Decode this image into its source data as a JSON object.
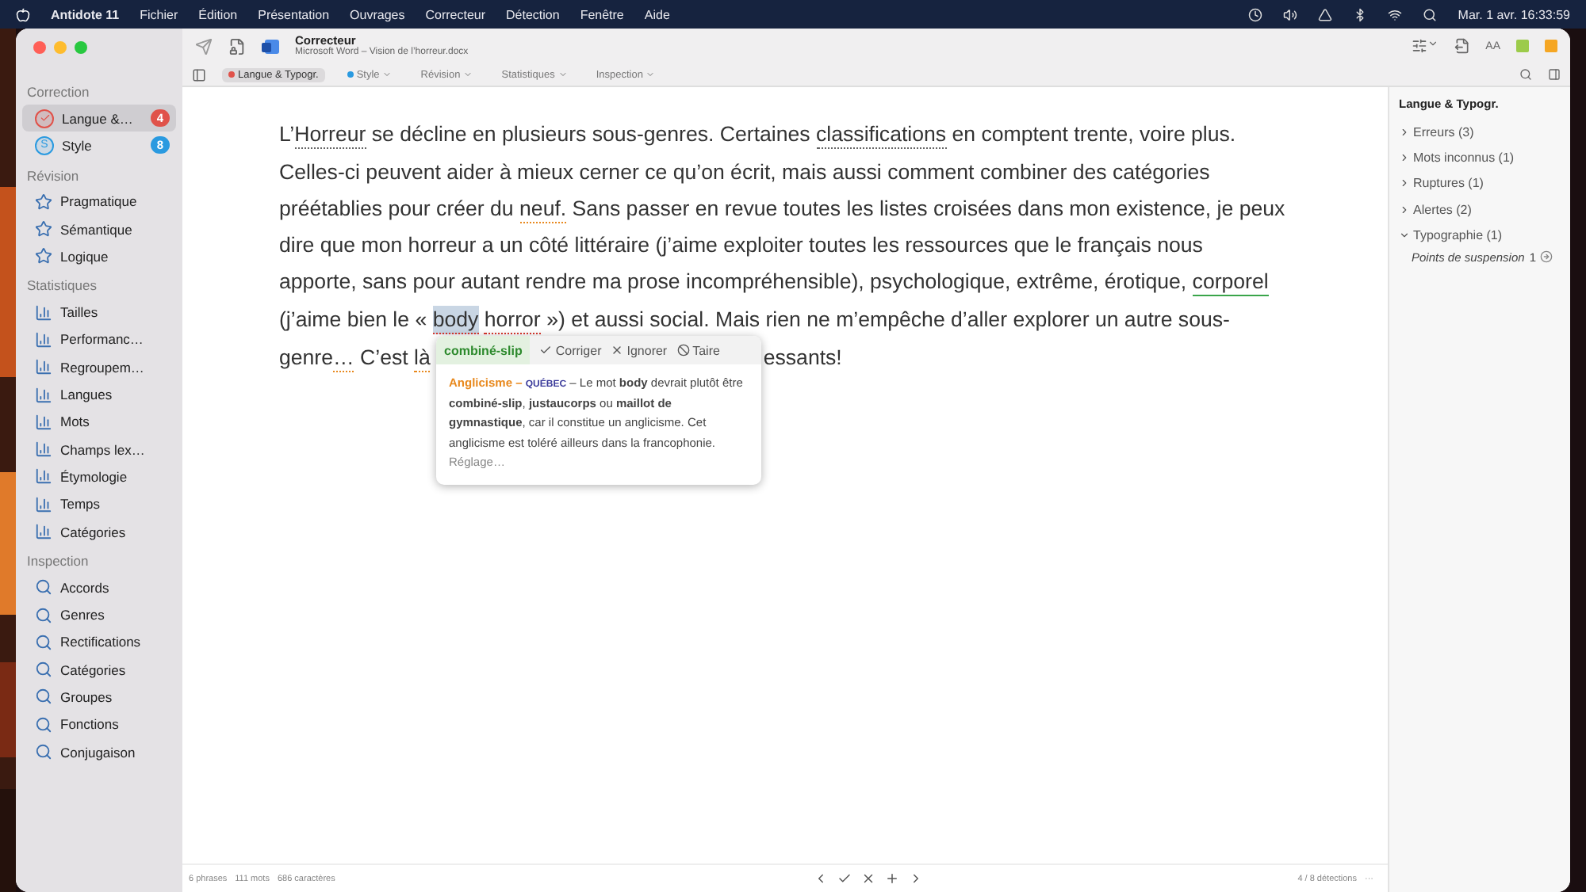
{
  "menu_bar": {
    "app": "Antidote 11",
    "menus": [
      "Fichier",
      "Édition",
      "Présentation",
      "Ouvrages",
      "Correcteur",
      "Détection",
      "Fenêtre",
      "Aide"
    ],
    "clock": "Mar. 1 avr. 16:33:59"
  },
  "toolbar": {
    "title": "Correcteur",
    "subtitle": "Microsoft Word – Vision de l’horreur.docx",
    "font_button": "AA"
  },
  "tabs": [
    {
      "label": "Langue & Typogr.",
      "selected": true,
      "color": "#e0524a"
    },
    {
      "label": "Style",
      "selected": false,
      "color": "#2a9ae0"
    },
    {
      "label": "Révision",
      "selected": false
    },
    {
      "label": "Statistiques",
      "selected": false
    },
    {
      "label": "Inspection",
      "selected": false
    }
  ],
  "sidebar": {
    "sections": [
      {
        "title": "Correction",
        "items": [
          {
            "label": "Langue &…",
            "kind": "check",
            "selected": true,
            "badge": "4",
            "color": "#e0524a"
          },
          {
            "label": "Style",
            "kind": "letter",
            "symbol": "S",
            "selected": false,
            "badge": "8",
            "color": "#2a9ae0"
          }
        ]
      },
      {
        "title": "Révision",
        "items": [
          {
            "label": "Pragmatique",
            "kind": "star",
            "selected": false
          },
          {
            "label": "Sémantique",
            "kind": "star",
            "selected": false
          },
          {
            "label": "Logique",
            "kind": "star",
            "selected": false
          }
        ]
      },
      {
        "title": "Statistiques",
        "items": [
          {
            "label": "Tailles",
            "kind": "bars",
            "selected": false
          },
          {
            "label": "Performanc…",
            "kind": "bars",
            "selected": false
          },
          {
            "label": "Regroupem…",
            "kind": "bars",
            "selected": false
          },
          {
            "label": "Langues",
            "kind": "bars",
            "selected": false
          },
          {
            "label": "Mots",
            "kind": "bars",
            "selected": false
          },
          {
            "label": "Champs lex…",
            "kind": "bars",
            "selected": false
          },
          {
            "label": "Étymologie",
            "kind": "bars",
            "selected": false
          },
          {
            "label": "Temps",
            "kind": "bars",
            "selected": false
          },
          {
            "label": "Catégories",
            "kind": "bars",
            "selected": false
          }
        ]
      },
      {
        "title": "Inspection",
        "items": [
          {
            "label": "Accords",
            "kind": "search",
            "selected": false
          },
          {
            "label": "Genres",
            "kind": "search",
            "selected": false
          },
          {
            "label": "Rectifications",
            "kind": "search",
            "selected": false
          },
          {
            "label": "Catégories",
            "kind": "search",
            "selected": false
          },
          {
            "label": "Groupes",
            "kind": "search",
            "selected": false
          },
          {
            "label": "Fonctions",
            "kind": "search",
            "selected": false
          },
          {
            "label": "Conjugaison",
            "kind": "search",
            "selected": false
          }
        ]
      }
    ]
  },
  "document": {
    "lines": [
      [
        {
          "text": "L’",
          "kind": "plain"
        },
        {
          "text": "Horreur",
          "kind": "grey"
        },
        {
          "text": " se décline en plusieurs sous-genres. Certaines ",
          "kind": "plain"
        },
        {
          "text": "classifications",
          "kind": "grey"
        },
        {
          "text": " en comptent trente, voire plus.",
          "kind": "plain"
        }
      ],
      [
        {
          "text": "Celles-ci peuvent aider à mieux cerner ce qu’on écrit, mais aussi comment combiner des catégories",
          "kind": "plain"
        }
      ],
      [
        {
          "text": "préétablies pour créer du ",
          "kind": "plain"
        },
        {
          "text": "neuf.",
          "kind": "orange"
        },
        {
          "text": " Sans passer en revue toutes les listes croisées dans mon existence, je peux",
          "kind": "plain"
        }
      ],
      [
        {
          "text": "dire que mon horreur a un côté littéraire (j’aime exploiter toutes les ressources que le français nous",
          "kind": "plain"
        }
      ],
      [
        {
          "text": "apporte, sans pour autant rendre ma prose incompréhensible), psychologique, extrême, érotique, ",
          "kind": "plain"
        },
        {
          "text": "corporel",
          "kind": "green"
        }
      ],
      [
        {
          "text": "(j’aime bien le « ",
          "kind": "plain"
        },
        {
          "text": "body",
          "kind": "selected"
        },
        {
          "text": "horror",
          "kind": "red"
        },
        {
          "text": " ») et aussi social. Mais rien ne m’empêche d’aller explorer un autre sous-",
          "kind": "plain"
        }
      ],
      [
        {
          "text": "genre",
          "kind": "plain"
        },
        {
          "text": "…",
          "kind": "orange"
        },
        {
          "text": " C’est ",
          "kind": "plain"
        },
        {
          "text": "là",
          "kind": "orange"
        },
        {
          "text": "essants!",
          "kind": "tail"
        }
      ]
    ]
  },
  "popup": {
    "suggestion": "combiné-slip",
    "actions": [
      {
        "label": "Corriger",
        "kind": "check"
      },
      {
        "label": "Ignorer",
        "kind": "x"
      },
      {
        "label": "Taire",
        "kind": "ban"
      }
    ],
    "category": "Anglicisme –",
    "region": "QUÉBEC",
    "text": "– Le mot **body** devrait plutôt être **combiné-slip**, **justaucorps** ou **maillot de gymnastique**, car il constitue un anglicisme. Cet anglicisme est toléré ailleurs dans la francophonie.",
    "link": "Réglage…"
  },
  "right_panel": {
    "title": "Langue & Typogr.",
    "items": [
      {
        "label": "Erreurs (3)",
        "expanded": false
      },
      {
        "label": "Mots inconnus (1)",
        "expanded": false
      },
      {
        "label": "Ruptures (1)",
        "expanded": false
      },
      {
        "label": "Alertes (2)",
        "expanded": false
      },
      {
        "label": "Typographie (1)",
        "expanded": true,
        "children": [
          {
            "label": "Points de suspension",
            "count": "1"
          }
        ]
      }
    ]
  },
  "status_bar": {
    "stats": [
      "6 phrases",
      "111 mots",
      "686 caractères"
    ],
    "detections": "4 / 8 détections",
    "more": "···"
  }
}
